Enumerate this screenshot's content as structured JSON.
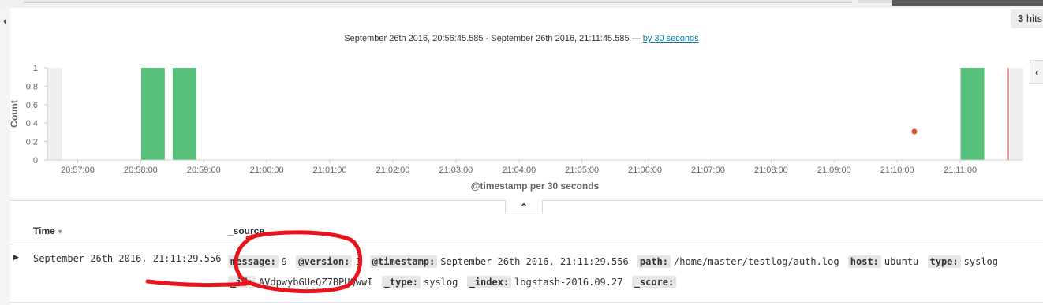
{
  "hits": {
    "count": "3",
    "label": "hits"
  },
  "time_range": {
    "text": "September 26th 2016, 20:56:45.585 - September 26th 2016, 21:11:45.585 —",
    "interval_link": "by 30 seconds"
  },
  "chart_data": {
    "type": "bar",
    "xlabel": "@timestamp per 30 seconds",
    "ylabel": "Count",
    "ylim": [
      0,
      1
    ],
    "y_ticks": [
      "0",
      "0.2",
      "0.4",
      "0.6",
      "0.8",
      "1"
    ],
    "x_ticks": [
      "20:57:00",
      "20:58:00",
      "20:59:00",
      "21:00:00",
      "21:01:00",
      "21:02:00",
      "21:03:00",
      "21:04:00",
      "21:05:00",
      "21:06:00",
      "21:07:00",
      "21:08:00",
      "21:09:00",
      "21:10:00",
      "21:11:00"
    ],
    "series": [
      {
        "values": [
          {
            "bucket": "20:58:00",
            "value": 1
          },
          {
            "bucket": "20:58:30",
            "value": 1
          },
          {
            "bucket": "21:11:00",
            "value": 1
          }
        ]
      }
    ],
    "bar_color": "#57c17b",
    "now_marker_color": "#e74c3c",
    "grid": false
  },
  "table": {
    "columns": {
      "time": "Time",
      "source": "_source"
    },
    "rows": [
      {
        "time": "September 26th 2016, 21:11:29.556",
        "fields": [
          {
            "key": "message:",
            "value": "9"
          },
          {
            "key": "@version:",
            "value": "1"
          },
          {
            "key": "@timestamp:",
            "value": "September 26th 2016, 21:11:29.556"
          },
          {
            "key": "path:",
            "value": "/home/master/testlog/auth.log"
          },
          {
            "key": "host:",
            "value": "ubuntu"
          },
          {
            "key": "type:",
            "value": "syslog"
          },
          {
            "key": "_id:",
            "value": "AVdpwybGUeQZ7BPUQwwI"
          },
          {
            "key": "_type:",
            "value": "syslog"
          },
          {
            "key": "_index:",
            "value": "logstash-2016.09.27"
          },
          {
            "key": "_score:",
            "value": ""
          }
        ]
      }
    ]
  },
  "icons": {
    "left_toggle": "chevron-left-icon",
    "right_toggle": "chevron-left-icon",
    "collapse": "chevron-up-icon",
    "expand_row": "caret-right-icon",
    "sort": "caret-down-icon"
  },
  "colors": {
    "accent": "#0079a5",
    "bar": "#57c17b",
    "annotation": "#e8141c"
  }
}
